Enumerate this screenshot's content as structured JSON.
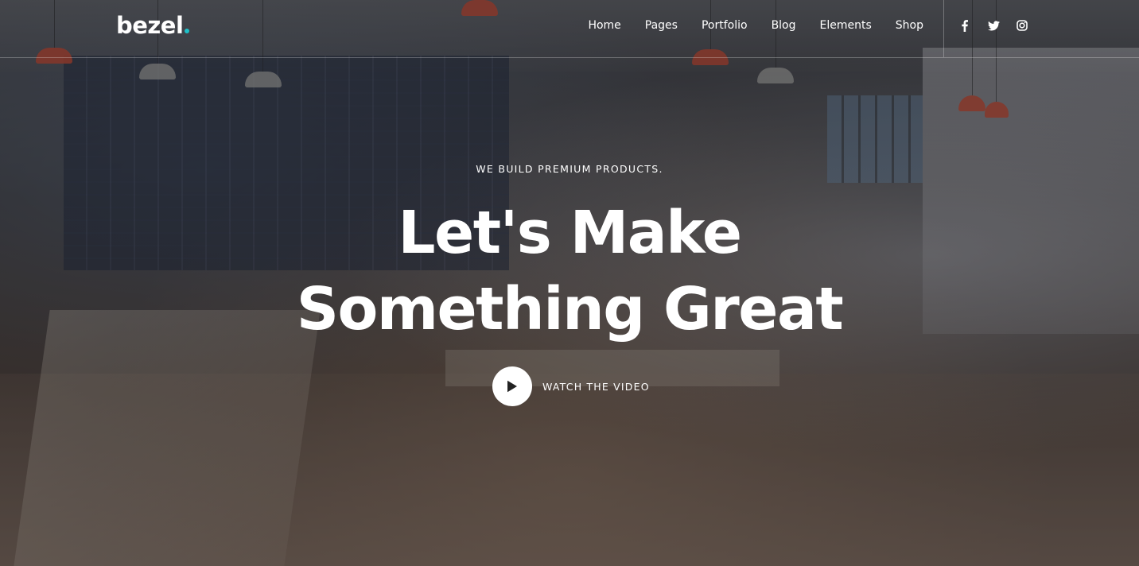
{
  "brand": {
    "logo_text": "bezel",
    "accent_color": "#1ec1c9"
  },
  "nav": {
    "items": [
      {
        "label": "Home"
      },
      {
        "label": "Pages"
      },
      {
        "label": "Portfolio"
      },
      {
        "label": "Blog"
      },
      {
        "label": "Elements"
      },
      {
        "label": "Shop"
      }
    ]
  },
  "social": {
    "icons": [
      "facebook-icon",
      "twitter-icon",
      "instagram-icon"
    ]
  },
  "hero": {
    "tagline": "WE BUILD PREMIUM PRODUCTS.",
    "headline_line1": "Let's Make",
    "headline_line2": "Something Great",
    "video_cta_label": "WATCH THE VIDEO",
    "play_icon": "play-icon"
  },
  "colors": {
    "text": "#ffffff",
    "play_button_bg": "#ffffff",
    "play_icon": "#222222"
  }
}
